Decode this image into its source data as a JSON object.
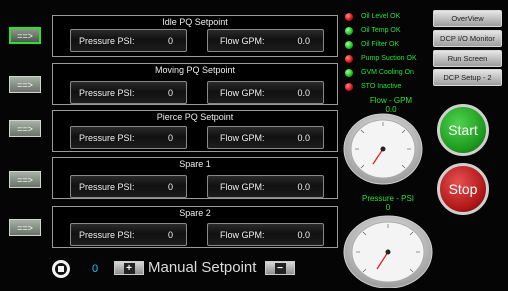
{
  "setpoints": [
    {
      "title": "Idle PQ Setpoint",
      "pressure_label": "Pressure PSI:",
      "pressure_value": "0",
      "flow_label": "Flow GPM:",
      "flow_value": "0.0"
    },
    {
      "title": "Moving PQ Setpoint",
      "pressure_label": "Pressure PSI:",
      "pressure_value": "0",
      "flow_label": "Flow GPM:",
      "flow_value": "0.0"
    },
    {
      "title": "Pierce PQ Setpoint",
      "pressure_label": "Pressure PSI:",
      "pressure_value": "0",
      "flow_label": "Flow GPM:",
      "flow_value": "0.0"
    },
    {
      "title": "Spare 1",
      "pressure_label": "Pressure PSI:",
      "pressure_value": "0",
      "flow_label": "Flow GPM:",
      "flow_value": "0.0"
    },
    {
      "title": "Spare 2",
      "pressure_label": "Pressure PSI:",
      "pressure_value": "0",
      "flow_label": "Flow GPM:",
      "flow_value": "0.0"
    }
  ],
  "select_button_label": "==>",
  "status_indicators": [
    {
      "label": "Oil Level OK",
      "color": "red"
    },
    {
      "label": "Oil Temp OK",
      "color": "green"
    },
    {
      "label": "Oil Filter OK",
      "color": "green"
    },
    {
      "label": "Pump Suction OK",
      "color": "red"
    },
    {
      "label": "GVM Cooling On",
      "color": "green"
    },
    {
      "label": "STO Inactive",
      "color": "red"
    }
  ],
  "nav_buttons": [
    "OverView",
    "DCP I/O Monitor",
    "Run Screen",
    "DCP Setup - 2"
  ],
  "flow_gauge": {
    "title": "Flow - GPM",
    "value": "0.0"
  },
  "pressure_gauge": {
    "title": "Pressure - PSI",
    "value": "0"
  },
  "start_label": "Start",
  "stop_label": "Stop",
  "manual": {
    "value": "0",
    "plus": "+",
    "minus": "−",
    "label": "Manual Setpoint"
  },
  "colors": {
    "accent_green": "#2ee02e",
    "start": "#1e9a1e",
    "stop": "#b01818",
    "value_cyan": "#19c6ff"
  }
}
